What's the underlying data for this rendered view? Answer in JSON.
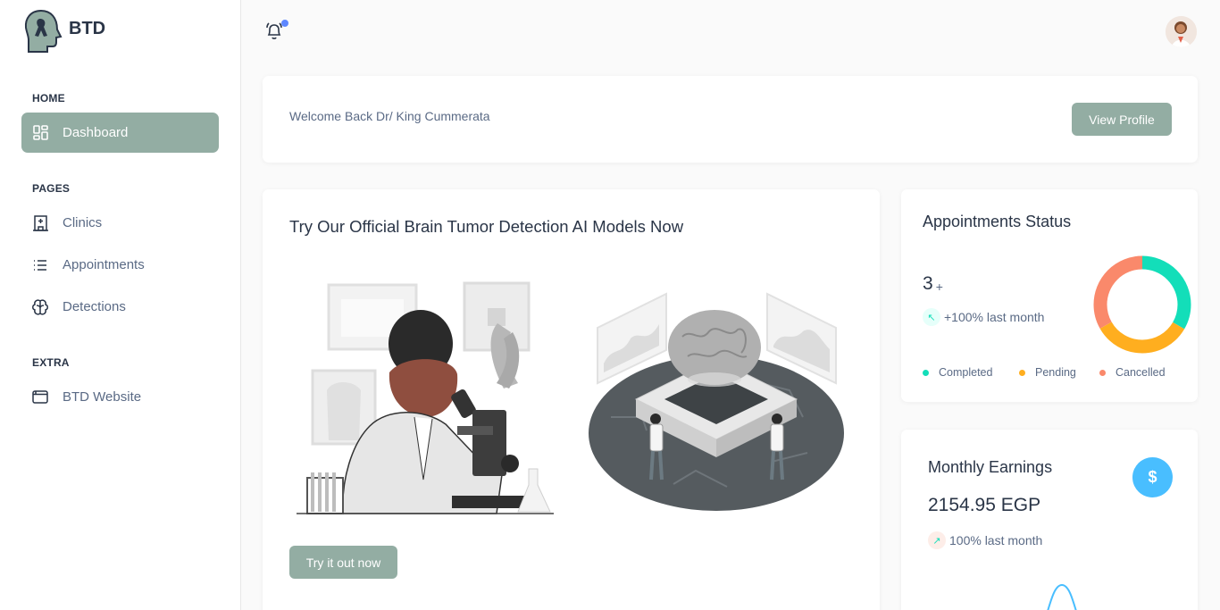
{
  "brand": {
    "name": "BTD",
    "logo_icon": "brain-head-ribbon-icon"
  },
  "sidebar": {
    "sections": [
      {
        "label": "HOME",
        "items": [
          {
            "label": "Dashboard",
            "icon": "dashboard-icon",
            "active": true
          }
        ]
      },
      {
        "label": "PAGES",
        "items": [
          {
            "label": "Clinics",
            "icon": "clinic-icon"
          },
          {
            "label": "Appointments",
            "icon": "list-icon"
          },
          {
            "label": "Detections",
            "icon": "brain-icon"
          }
        ]
      },
      {
        "label": "EXTRA",
        "items": [
          {
            "label": "BTD Website",
            "icon": "browser-icon"
          }
        ]
      }
    ]
  },
  "header": {
    "notification_icon": "bell-icon",
    "has_notification": true,
    "avatar_icon": "user-avatar"
  },
  "welcome": {
    "text": "Welcome Back Dr/ King Cummerata",
    "button": "View Profile"
  },
  "ai_card": {
    "title": "Try Our Official Brain Tumor Detection AI Models Now",
    "button": "Try it out now"
  },
  "appointments": {
    "title": "Appointments Status",
    "count": "3",
    "count_suffix": "+",
    "trend": "+100% last month",
    "trend_icon": "arrow-up-left-icon",
    "legend": [
      {
        "label": "Completed",
        "color": "#13deb9",
        "value": 1
      },
      {
        "label": "Pending",
        "color": "#ffae1f",
        "value": 1
      },
      {
        "label": "Cancelled",
        "color": "#fa896b",
        "value": 1
      }
    ]
  },
  "earnings": {
    "title": "Monthly Earnings",
    "amount": "2154.95 EGP",
    "trend": "100% last month",
    "trend_icon": "arrow-up-right-icon",
    "currency_icon": "$"
  },
  "colors": {
    "accent": "#93ada3",
    "text": "#2a3547",
    "muted": "#5a6a85",
    "info": "#49beff",
    "primary": "#5d87ff"
  }
}
